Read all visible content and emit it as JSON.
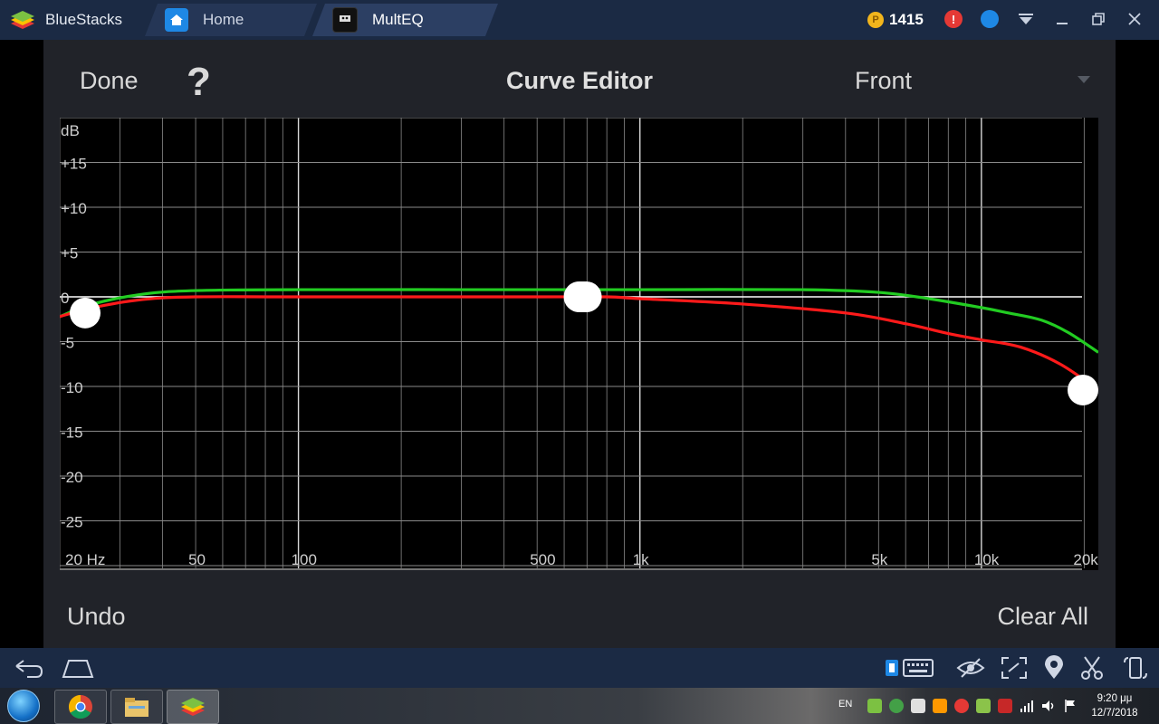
{
  "window": {
    "brand": "BlueStacks",
    "tabs": [
      {
        "label": "Home"
      },
      {
        "label": "MultEQ"
      }
    ],
    "coins": "1415"
  },
  "app": {
    "done_label": "Done",
    "help_label": "?",
    "title": "Curve Editor",
    "channel": "Front",
    "undo_label": "Undo",
    "clear_all_label": "Clear All"
  },
  "chart_data": {
    "type": "line",
    "title": "",
    "xlabel": "",
    "ylabel": "dB",
    "x_scale": "log",
    "xlim": [
      20,
      22000
    ],
    "ylim": [
      -30,
      20
    ],
    "grid": true,
    "x_ticks": [
      {
        "value": 20,
        "label": "20 Hz"
      },
      {
        "value": 50,
        "label": "50"
      },
      {
        "value": 100,
        "label": "100"
      },
      {
        "value": 500,
        "label": "500"
      },
      {
        "value": 1000,
        "label": "1k"
      },
      {
        "value": 5000,
        "label": "5k"
      },
      {
        "value": 10000,
        "label": "10k"
      },
      {
        "value": 20000,
        "label": "20k"
      }
    ],
    "y_ticks": [
      {
        "value": 15,
        "label": "+15"
      },
      {
        "value": 10,
        "label": "+10"
      },
      {
        "value": 5,
        "label": "+5"
      },
      {
        "value": 0,
        "label": "0"
      },
      {
        "value": -5,
        "label": "-5"
      },
      {
        "value": -10,
        "label": "-10"
      },
      {
        "value": -15,
        "label": "-15"
      },
      {
        "value": -20,
        "label": "-20"
      },
      {
        "value": -25,
        "label": "-25"
      }
    ],
    "series": [
      {
        "color": "#22cc22",
        "points": [
          [
            20,
            -2.2
          ],
          [
            25,
            -0.8
          ],
          [
            35,
            0.3
          ],
          [
            50,
            0.7
          ],
          [
            100,
            0.8
          ],
          [
            500,
            0.8
          ],
          [
            1000,
            0.8
          ],
          [
            3000,
            0.8
          ],
          [
            5000,
            0.5
          ],
          [
            7000,
            -0.2
          ],
          [
            10000,
            -1.2
          ],
          [
            12000,
            -1.8
          ],
          [
            15000,
            -2.6
          ],
          [
            18000,
            -4.0
          ],
          [
            22000,
            -6.2
          ]
        ]
      },
      {
        "color": "#ff1a1a",
        "points": [
          [
            20,
            -2.2
          ],
          [
            25,
            -1.2
          ],
          [
            35,
            -0.3
          ],
          [
            50,
            0
          ],
          [
            100,
            0
          ],
          [
            500,
            0
          ],
          [
            800,
            0
          ],
          [
            1000,
            -0.2
          ],
          [
            2000,
            -0.8
          ],
          [
            4000,
            -1.8
          ],
          [
            6000,
            -3.0
          ],
          [
            8000,
            -4.1
          ],
          [
            10000,
            -4.8
          ],
          [
            13000,
            -5.6
          ],
          [
            17000,
            -7.5
          ],
          [
            22000,
            -10.4
          ]
        ]
      }
    ],
    "handles": [
      [
        20,
        -1.8
      ],
      [
        680,
        0
      ],
      [
        22000,
        -10.4
      ]
    ]
  },
  "navbar": {
    "icons": [
      "back-icon",
      "home-icon",
      "keyboard-icon",
      "eye-icon",
      "fullscreen-icon",
      "location-icon",
      "scissors-icon",
      "rotate-icon"
    ]
  },
  "taskbar": {
    "language": "EN",
    "time": "9:20 μμ",
    "date": "12/7/2018"
  }
}
